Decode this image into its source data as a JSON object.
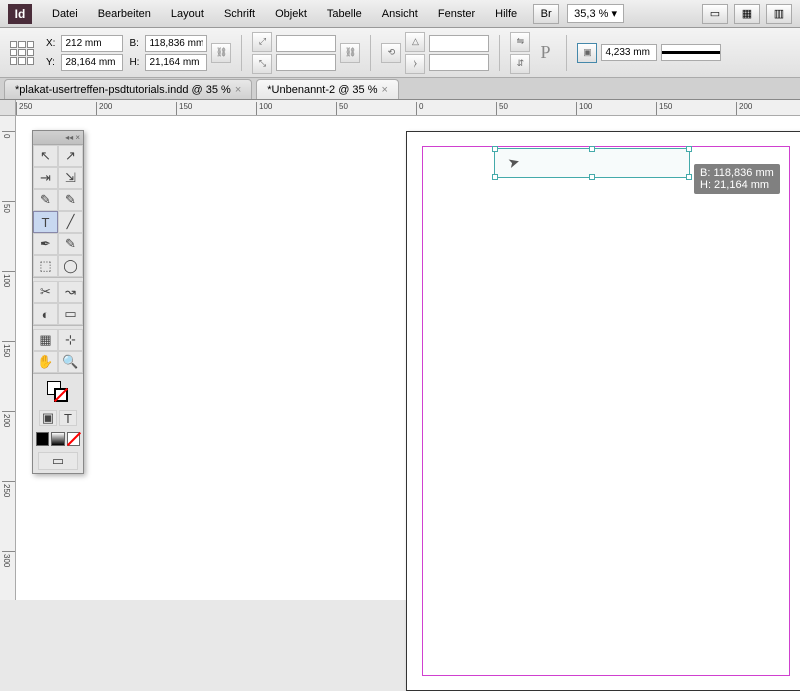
{
  "app": {
    "logo": "Id"
  },
  "menu": [
    "Datei",
    "Bearbeiten",
    "Layout",
    "Schrift",
    "Objekt",
    "Tabelle",
    "Ansicht",
    "Fenster",
    "Hilfe"
  ],
  "bridge": "Br",
  "zoom": "35,3 %",
  "coords": {
    "x_label": "X:",
    "x": "212 mm",
    "y_label": "Y:",
    "y": "28,164 mm",
    "w_label": "B:",
    "w": "118,836 mm",
    "h_label": "H:",
    "h": "21,164 mm"
  },
  "stroke": "4,233 mm",
  "tabs": [
    {
      "title": "*plakat-usertreffen-psdtutorials.indd @ 35 %",
      "active": false
    },
    {
      "title": "*Unbenannt-2 @ 35 %",
      "active": true
    }
  ],
  "ruler_h": [
    "250",
    "200",
    "150",
    "100",
    "50",
    "0",
    "50",
    "100",
    "150",
    "200"
  ],
  "ruler_v": [
    "0",
    "50",
    "100",
    "150",
    "200",
    "250",
    "300"
  ],
  "tooltip": {
    "b": "B: 118,836 mm",
    "h": "H: 21,164 mm"
  },
  "tools": [
    "↖",
    "↗",
    "⇥",
    "⇲",
    "✎",
    "✎",
    "T",
    "╱",
    "✒",
    "✎",
    "⬚",
    "◯",
    "✂",
    "↝",
    "◐",
    "▭",
    "▦",
    "⊹",
    "✋",
    "🔍"
  ]
}
